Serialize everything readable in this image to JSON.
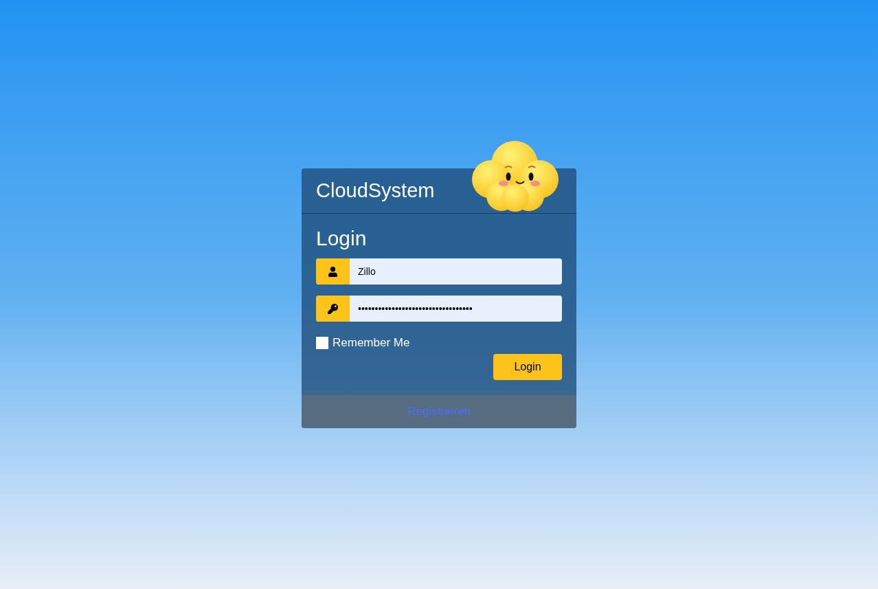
{
  "brand": {
    "title": "CloudSystem"
  },
  "form": {
    "heading": "Login",
    "fields": [
      {
        "kind": "user",
        "value": "Zillo"
      },
      {
        "kind": "password",
        "value": "••••••••••••••••••••••••••••••••••"
      }
    ],
    "remember": {
      "label": "Remember Me",
      "checked": false
    },
    "submit": "Login"
  },
  "footer": {
    "link": "Registrieren"
  }
}
